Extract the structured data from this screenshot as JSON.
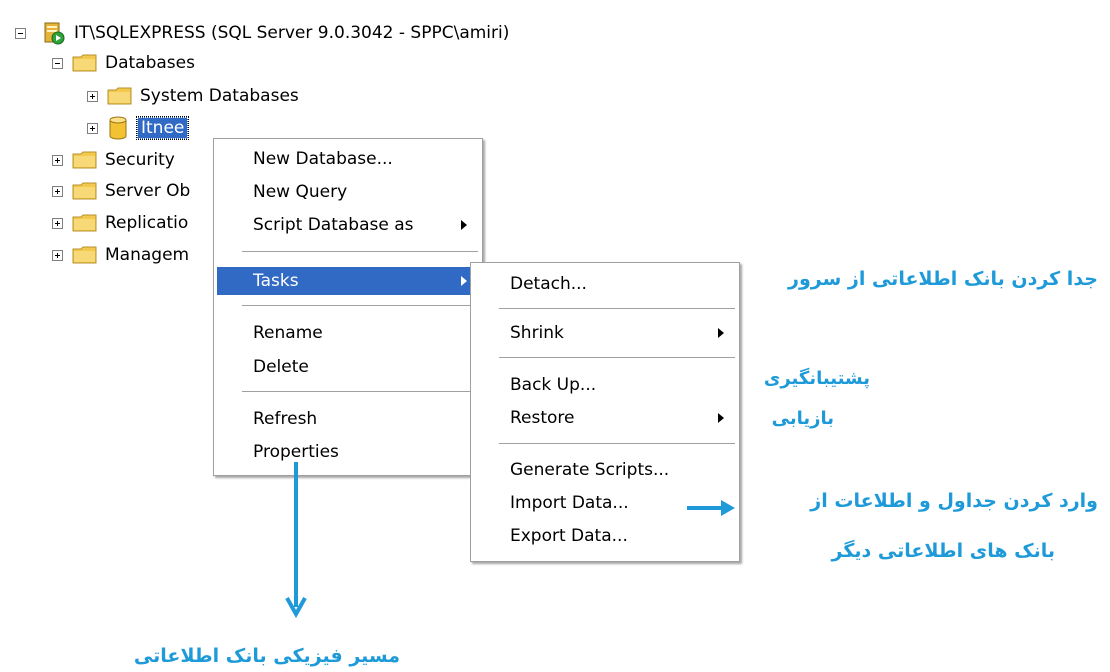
{
  "tree": {
    "server": "IT\\SQLEXPRESS (SQL Server 9.0.3042 - SPPC\\amiri)",
    "databases": "Databases",
    "system_databases": "System Databases",
    "itnee": "Itnee",
    "security": "Security",
    "server_objects": "Server Ob",
    "replication": "Replicatio",
    "management": "Managem"
  },
  "context_menu": {
    "items": [
      "New Database...",
      "New Query",
      "Script Database as",
      "Tasks",
      "Rename",
      "Delete",
      "Refresh",
      "Properties"
    ],
    "highlighted": "Tasks"
  },
  "tasks_menu": {
    "items": [
      "Detach...",
      "Shrink",
      "Back Up...",
      "Restore",
      "Generate Scripts...",
      "Import Data...",
      "Export Data..."
    ]
  },
  "annotations": {
    "detach": "جدا کردن بانک اطلاعاتی از سرور",
    "backup": "پشتیبانگیری",
    "restore": "بازیابی",
    "import_line1": "وارد کردن جداول و اطلاعات از",
    "import_line2": "بانک های اطلاعاتی دیگر",
    "properties": "مسیر فیزیکی بانک اطلاعاتی"
  },
  "colors": {
    "selection": "#316ac5",
    "annotation": "#1e9ad8",
    "folder": "#f2c94c"
  }
}
